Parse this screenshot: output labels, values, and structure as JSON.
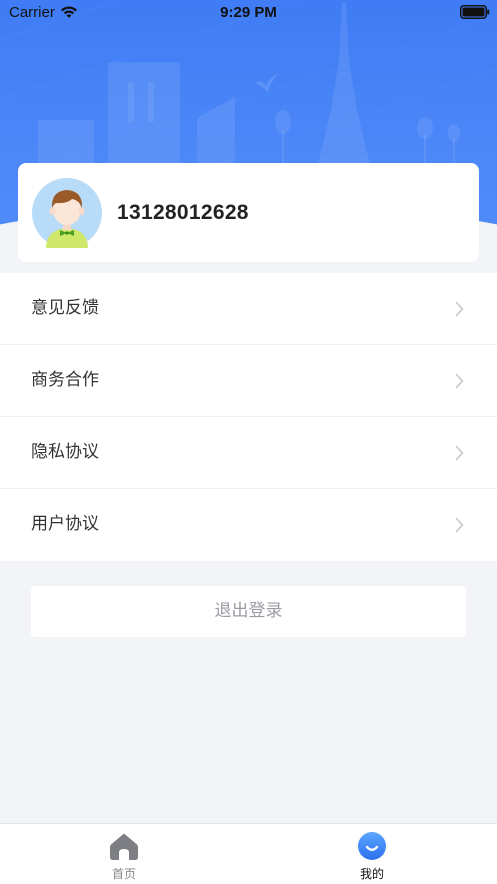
{
  "status_bar": {
    "carrier": "Carrier",
    "time": "9:29 PM",
    "wifi_icon": "wifi-icon",
    "battery_icon": "battery-full-icon"
  },
  "profile": {
    "phone": "13128012628",
    "avatar_icon": "avatar-boy-icon"
  },
  "menu": {
    "items": [
      {
        "label": "意见反馈",
        "icon": "chevron-right-icon"
      },
      {
        "label": "商务合作",
        "icon": "chevron-right-icon"
      },
      {
        "label": "隐私协议",
        "icon": "chevron-right-icon"
      },
      {
        "label": "用户协议",
        "icon": "chevron-right-icon"
      }
    ]
  },
  "logout": {
    "label": "退出登录"
  },
  "tab_bar": {
    "tabs": [
      {
        "label": "首页",
        "icon": "home-icon",
        "active": false
      },
      {
        "label": "我的",
        "icon": "smile-icon",
        "active": true
      }
    ]
  },
  "colors": {
    "brand_blue": "#3f7cf5",
    "background": "#f3f4f8",
    "active_tab": "#111111",
    "inactive_tab": "#888888"
  }
}
